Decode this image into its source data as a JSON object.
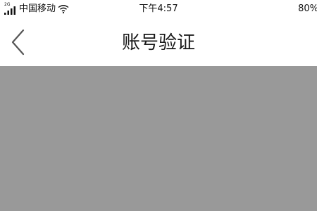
{
  "status_bar": {
    "network_type": "2G",
    "carrier": "中国移动",
    "time": "下午4:57",
    "battery": "80%"
  },
  "nav": {
    "title": "账号验证",
    "back_icon": "chevron-left-icon"
  },
  "content": {
    "background": "#999999"
  }
}
